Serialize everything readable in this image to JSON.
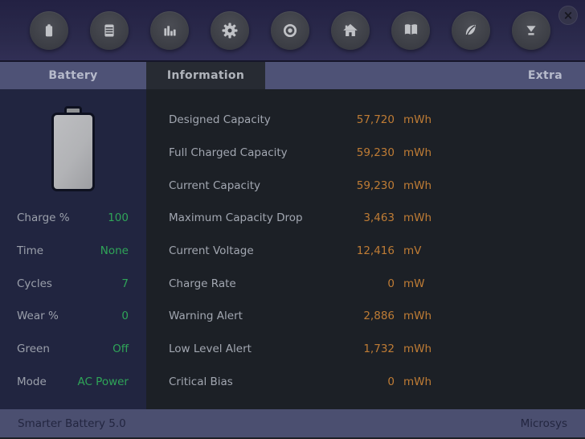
{
  "app": {
    "close_glyph": "×"
  },
  "toolbar": {
    "icons": [
      "battery",
      "list",
      "bar-chart",
      "gear",
      "target",
      "home",
      "book",
      "leaf",
      "funnel"
    ]
  },
  "tabs": [
    {
      "label": "Battery",
      "active": false
    },
    {
      "label": "Information",
      "active": true
    },
    {
      "label": "Extra",
      "active": false
    }
  ],
  "battery_panel": {
    "charge_percent": 100,
    "rows": [
      {
        "label": "Charge %",
        "value": "100"
      },
      {
        "label": "Time",
        "value": "None"
      },
      {
        "label": "Cycles",
        "value": "7"
      },
      {
        "label": "Wear %",
        "value": "0"
      },
      {
        "label": "Green",
        "value": "Off"
      },
      {
        "label": "Mode",
        "value": "AC Power"
      }
    ]
  },
  "info_panel": {
    "rows": [
      {
        "label": "Designed Capacity",
        "value": "57,720",
        "unit": "mWh"
      },
      {
        "label": "Full Charged Capacity",
        "value": "59,230",
        "unit": "mWh"
      },
      {
        "label": "Current Capacity",
        "value": "59,230",
        "unit": "mWh"
      },
      {
        "label": "Maximum Capacity Drop",
        "value": "3,463",
        "unit": "mWh"
      },
      {
        "label": "Current Voltage",
        "value": "12,416",
        "unit": "mV"
      },
      {
        "label": "Charge Rate",
        "value": "0",
        "unit": "mW"
      },
      {
        "label": "Warning Alert",
        "value": "2,886",
        "unit": "mWh"
      },
      {
        "label": "Low Level Alert",
        "value": "1,732",
        "unit": "mWh"
      },
      {
        "label": "Critical Bias",
        "value": "0",
        "unit": "mWh"
      }
    ]
  },
  "statusbar": {
    "left": "Smarter Battery 5.0",
    "right": "Microsys"
  },
  "colors": {
    "value_green": "#2fa558",
    "value_orange": "#bf7c35",
    "tab_bg": "#4e5276",
    "active_tab_bg": "#272b33",
    "left_panel_bg": "#212540",
    "right_panel_bg": "#1c2026",
    "status_bg": "#4b4f70",
    "toolbar_top": "#232143",
    "toolbar_bottom": "#312f55"
  }
}
